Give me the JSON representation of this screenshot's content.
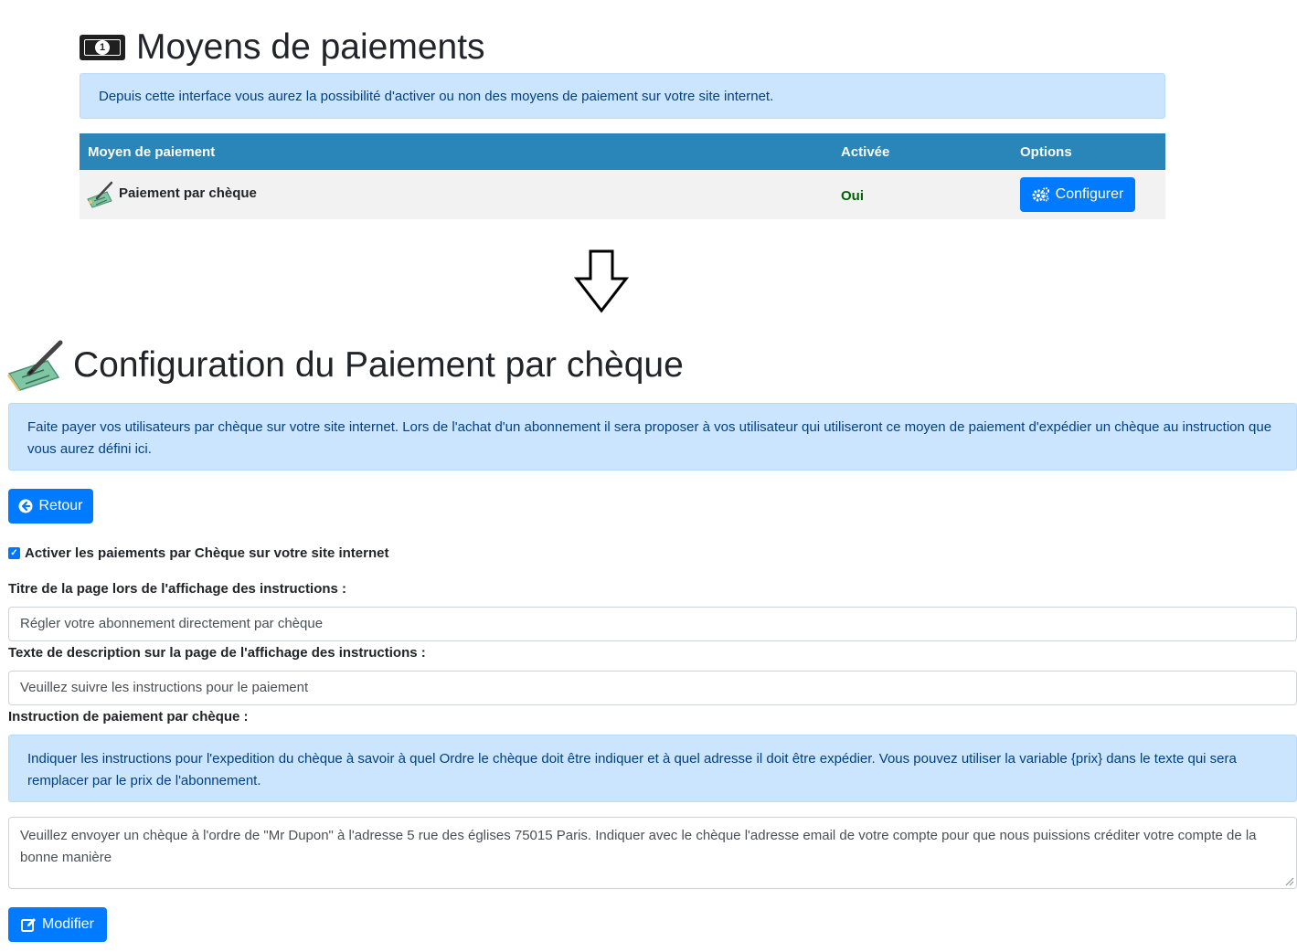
{
  "payments_section": {
    "title": "Moyens de paiements",
    "title_icon": "money-bill-icon",
    "info_text": "Depuis cette interface vous aurez la possibilité d'activer ou non des moyens de paiement sur votre site internet.",
    "table": {
      "columns": [
        "Moyen de paiement",
        "Activée",
        "Options"
      ],
      "rows": [
        {
          "name": "Paiement par chèque",
          "icon": "cheque-icon",
          "active": "Oui",
          "button": "Configurer",
          "button_icon": "cogs-icon"
        }
      ]
    },
    "colors": {
      "table_header": "#2a86b9",
      "active_text": "#006400",
      "primary": "#007bff",
      "alert_bg": "#cce5ff"
    }
  },
  "arrow_icon": "down-arrow-icon",
  "config_section": {
    "title": "Configuration du Paiement par chèque",
    "title_icon": "cheque-icon",
    "info_text": "Faite payer vos utilisateurs par chèque sur votre site internet. Lors de l'achat d'un abonnement il sera proposer à vos utilisateur qui utiliseront ce moyen de paiement d'expédier un chèque au instruction que vous aurez défini ici.",
    "back_button": "Retour",
    "activate_checkbox": {
      "label": "Activer les paiements par Chèque sur votre site internet",
      "checked": true
    },
    "page_title_field": {
      "label": "Titre de la page lors de l'affichage des instructions :",
      "value": "Régler votre abonnement directement par chèque"
    },
    "description_field": {
      "label": "Texte de description sur la page de l'affichage des instructions :",
      "value": "Veuillez suivre les instructions pour le paiement"
    },
    "instruction_field": {
      "label": "Instruction de paiement par chèque :",
      "help_text": "Indiquer les instructions pour l'expedition du chèque à savoir à quel Ordre le chèque doit être indiquer et à quel adresse il doit être expédier. Vous pouvez utiliser la variable {prix} dans le texte qui sera remplacer par le prix de l'abonnement.",
      "value": "Veuillez envoyer un chèque à l'ordre de \"Mr Dupon\" à l'adresse 5 rue des églises 75015 Paris. Indiquer avec le chèque l'adresse email de votre compte pour que nous puissions créditer votre compte de la bonne manière"
    },
    "submit_button": "Modifier"
  }
}
